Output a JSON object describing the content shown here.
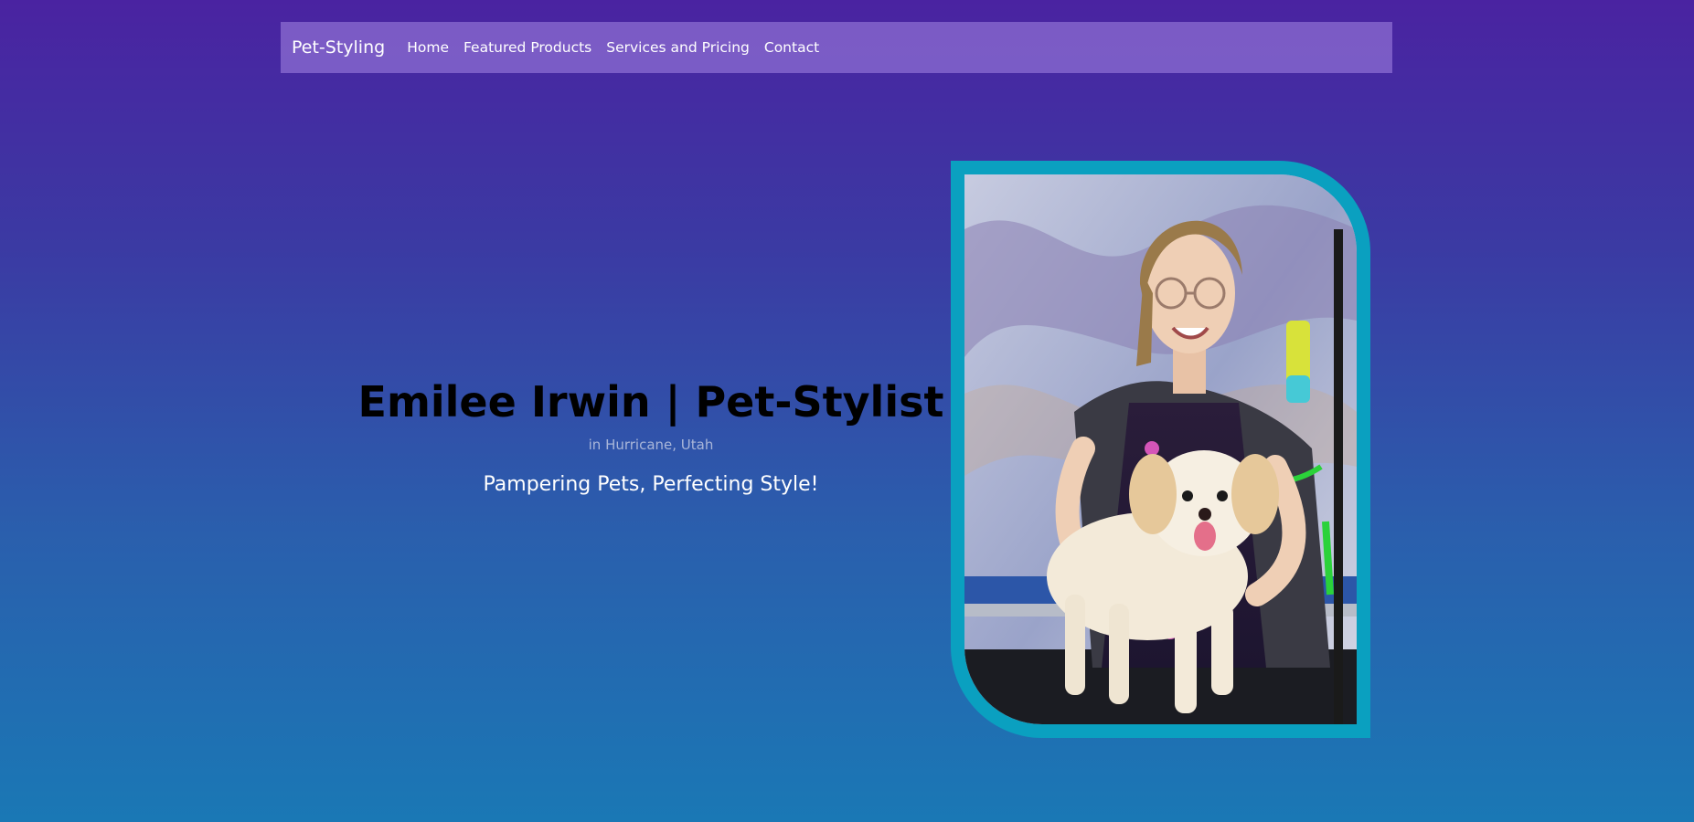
{
  "nav": {
    "brand": "Pet-Styling",
    "links": [
      "Home",
      "Featured Products",
      "Services and Pricing",
      "Contact"
    ]
  },
  "hero": {
    "title": "Emilee Irwin | Pet-Stylist",
    "location": "in Hurricane, Utah",
    "tagline": "Pampering Pets, Perfecting Style!"
  },
  "photo": {
    "description_icon": "groomer-with-dog-photo"
  },
  "colors": {
    "gradient_top": "#4a23a1",
    "gradient_bottom": "#1a78b5",
    "navbar": "#8c6ed2",
    "frame_accent": "#0aa0c0"
  }
}
